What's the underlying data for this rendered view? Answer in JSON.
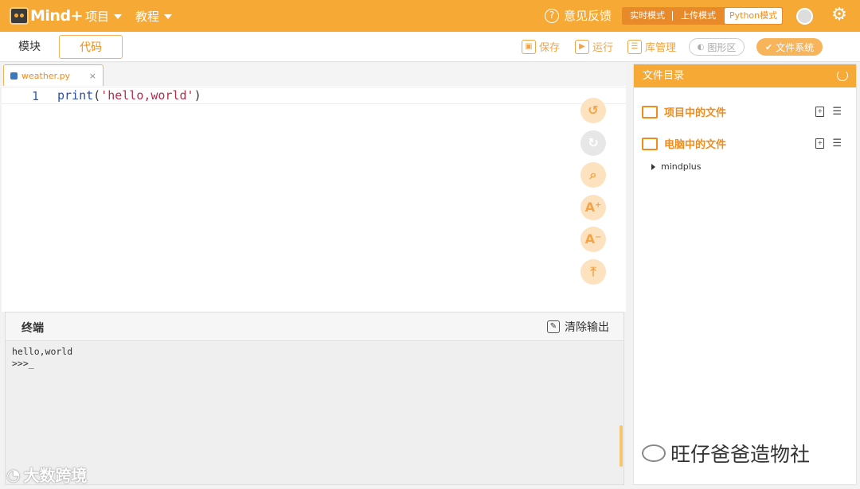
{
  "app": {
    "logo_text": "Mind+"
  },
  "topbar": {
    "menu_project": "项目",
    "menu_tutorial": "教程",
    "feedback": "意见反馈",
    "modes": [
      "实时模式",
      "上传模式",
      "Python模式"
    ],
    "active_mode": "Python模式"
  },
  "tabs": {
    "blocks": "模块",
    "code": "代码"
  },
  "toolbar": {
    "save": "保存",
    "run": "运行",
    "library": "库管理",
    "graphics": "图形区",
    "filesystem": "文件系统"
  },
  "editor": {
    "filename": "weather.py",
    "line_number": "1",
    "code_fn": "print",
    "code_open": "(",
    "code_string": "'hello,world'",
    "code_close": ")"
  },
  "terminal": {
    "title": "终端",
    "clear": "清除输出",
    "output_line1": "hello,world",
    "output_line2": ">>>_"
  },
  "filepanel": {
    "title": "文件目录",
    "section_project": "项目中的文件",
    "section_computer": "电脑中的文件",
    "tree_item": "mindplus"
  },
  "watermarks": {
    "left": "大数跨境",
    "right": "旺仔爸爸造物社"
  },
  "colors": {
    "accent": "#f7a935",
    "accent_dark": "#f08c1c"
  }
}
